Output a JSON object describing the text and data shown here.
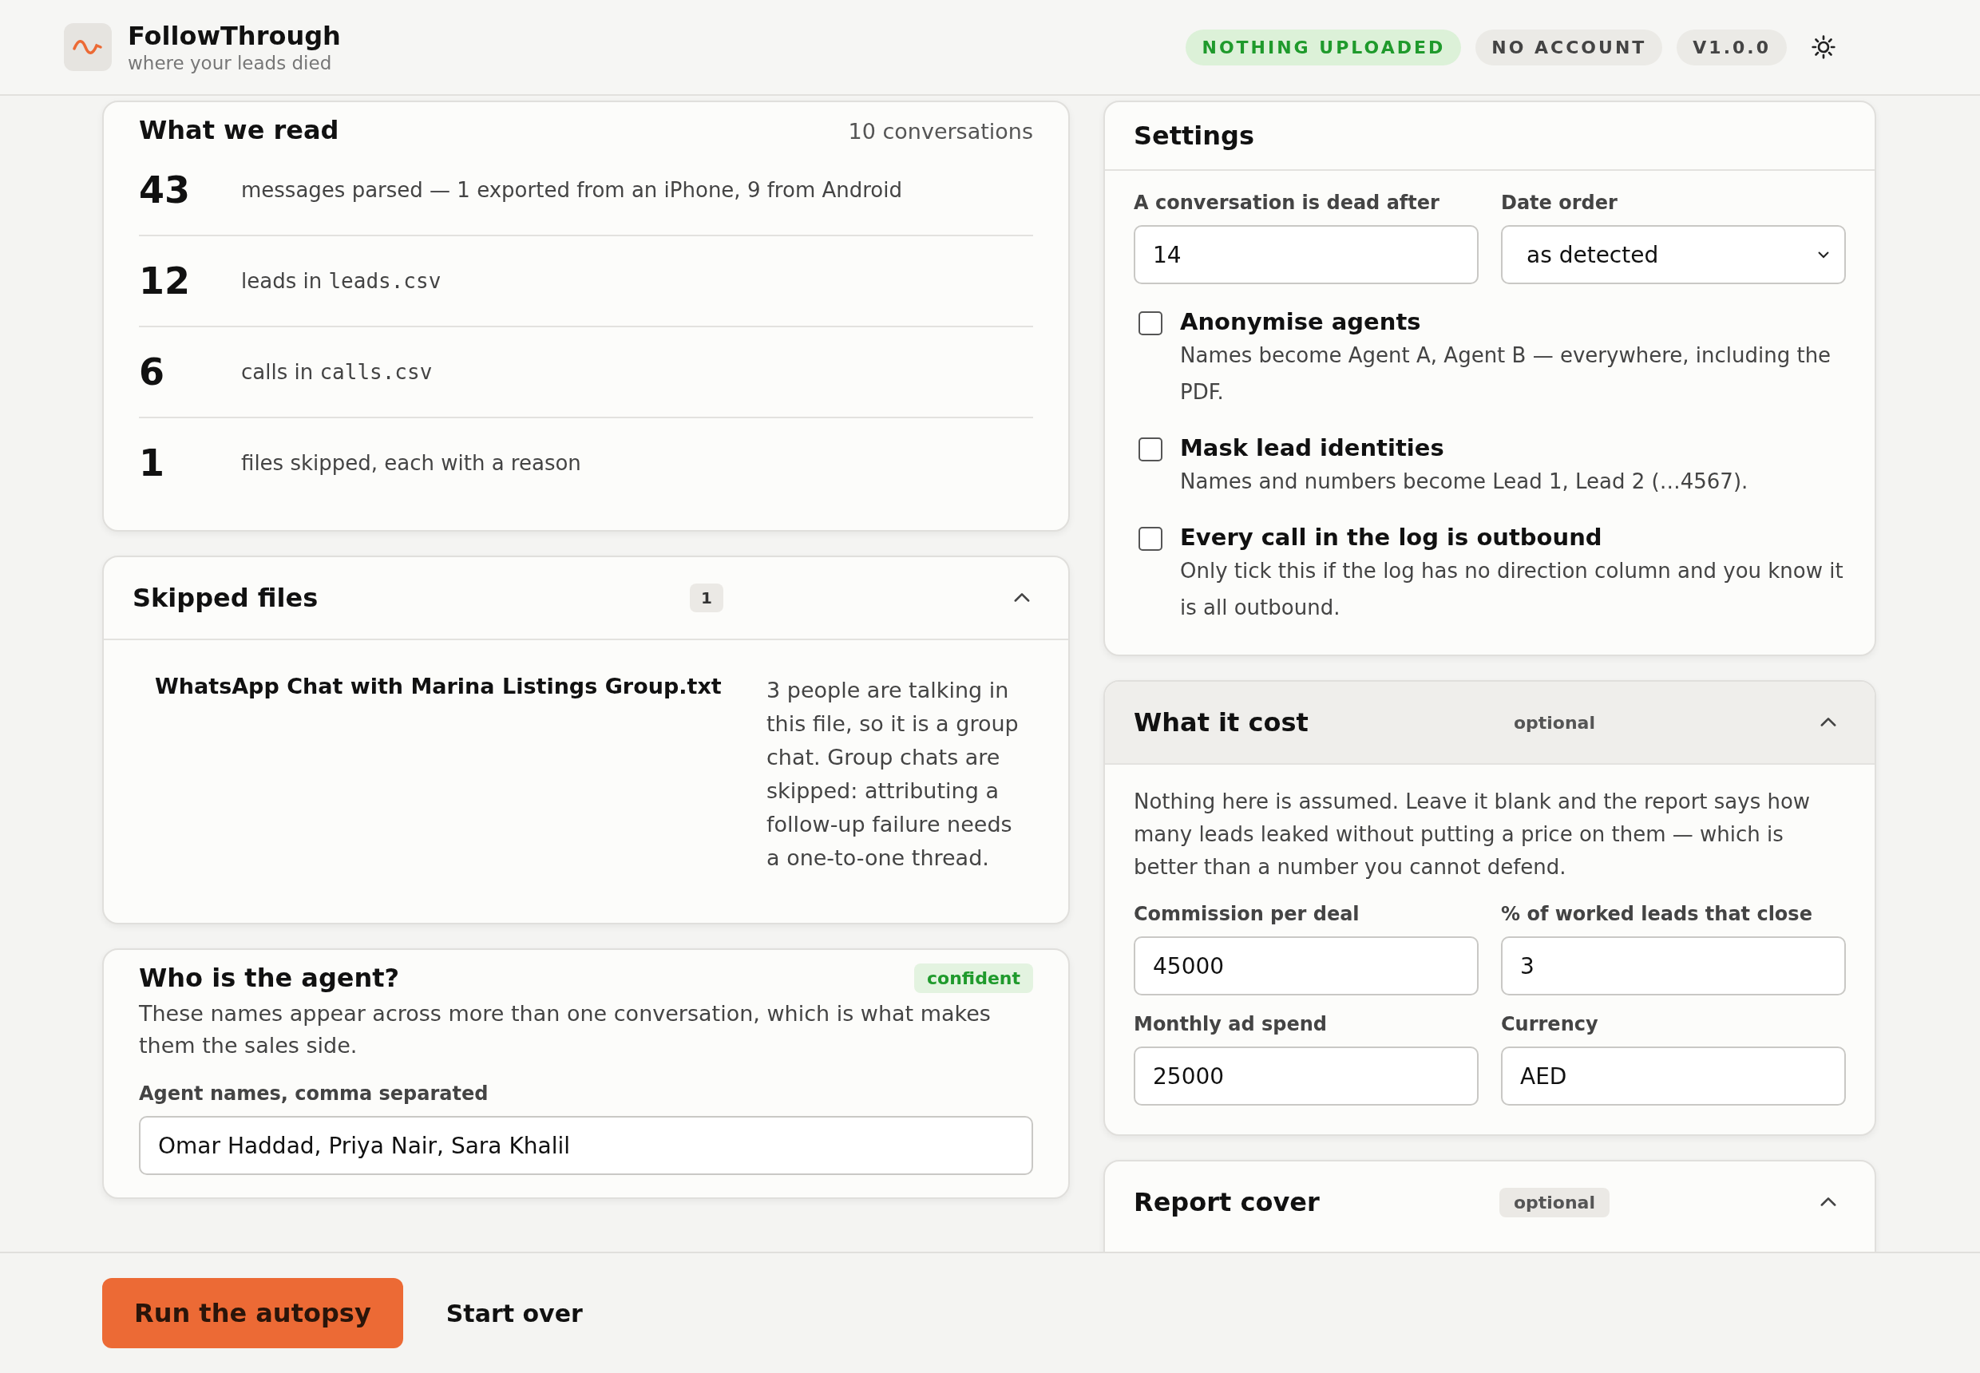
{
  "header": {
    "title": "FollowThrough",
    "subtitle": "where your leads died",
    "badges": [
      {
        "label": "NOTHING UPLOADED",
        "kind": "success"
      },
      {
        "label": "NO ACCOUNT",
        "kind": "neutral"
      },
      {
        "label": "V1.0.0",
        "kind": "neutral"
      }
    ]
  },
  "what_we_read": {
    "title": "What we read",
    "summary": "10 conversations",
    "stats": [
      {
        "value": "43",
        "text": "messages parsed — 1 exported from an iPhone, 9 from Android"
      },
      {
        "value": "12",
        "text": "leads in",
        "file": "leads.csv"
      },
      {
        "value": "6",
        "text": "calls in",
        "file": "calls.csv"
      },
      {
        "value": "1",
        "text": "files skipped, each with a reason"
      }
    ]
  },
  "skipped_files": {
    "title": "Skipped files",
    "count": "1",
    "expanded": true,
    "files": [
      {
        "name": "WhatsApp Chat with Marina Listings Group.txt",
        "reason": "3 people are talking in this file, so it is a group chat. Group chats are skipped: attributing a follow-up failure needs a one-to-one thread."
      }
    ]
  },
  "agent": {
    "title": "Who is the agent?",
    "confidence": "confident",
    "description": "These names appear across more than one conversation, which is what makes them the sales side.",
    "field": {
      "label": "Agent names, comma separated",
      "value": "Omar Haddad, Priya Nair, Sara Khalil"
    }
  },
  "settings": {
    "title": "Settings",
    "fields": [
      {
        "label": "A conversation is dead after",
        "kind": "input",
        "value": "14"
      },
      {
        "label": "Date order",
        "kind": "select",
        "value": "as detected"
      }
    ],
    "options": [
      {
        "label": "Anonymise agents",
        "description": "Names become Agent A, Agent B — everywhere, including the PDF.",
        "checked": false
      },
      {
        "label": "Mask lead identities",
        "description": "Names and numbers become Lead 1, Lead 2 (…4567).",
        "checked": false
      },
      {
        "label": "Every call in the log is outbound",
        "description": "Only tick this if the log has no direction column and you know it is all outbound.",
        "checked": false
      }
    ]
  },
  "cost": {
    "title": "What it cost",
    "tag": "optional",
    "expanded": true,
    "note": "Nothing here is assumed. Leave it blank and the report says how many leads leaked without putting a price on them — which is better than a number you cannot defend.",
    "fields": [
      {
        "label": "Commission per deal",
        "value": "45000"
      },
      {
        "label": "% of worked leads that close",
        "value": "3"
      },
      {
        "label": "Monthly ad spend",
        "value": "25000"
      },
      {
        "label": "Currency",
        "value": "AED"
      }
    ]
  },
  "report_cover": {
    "title": "Report cover",
    "tag": "optional",
    "expanded": true
  },
  "actions": {
    "primary": "Run the autopsy",
    "secondary": "Start over"
  }
}
